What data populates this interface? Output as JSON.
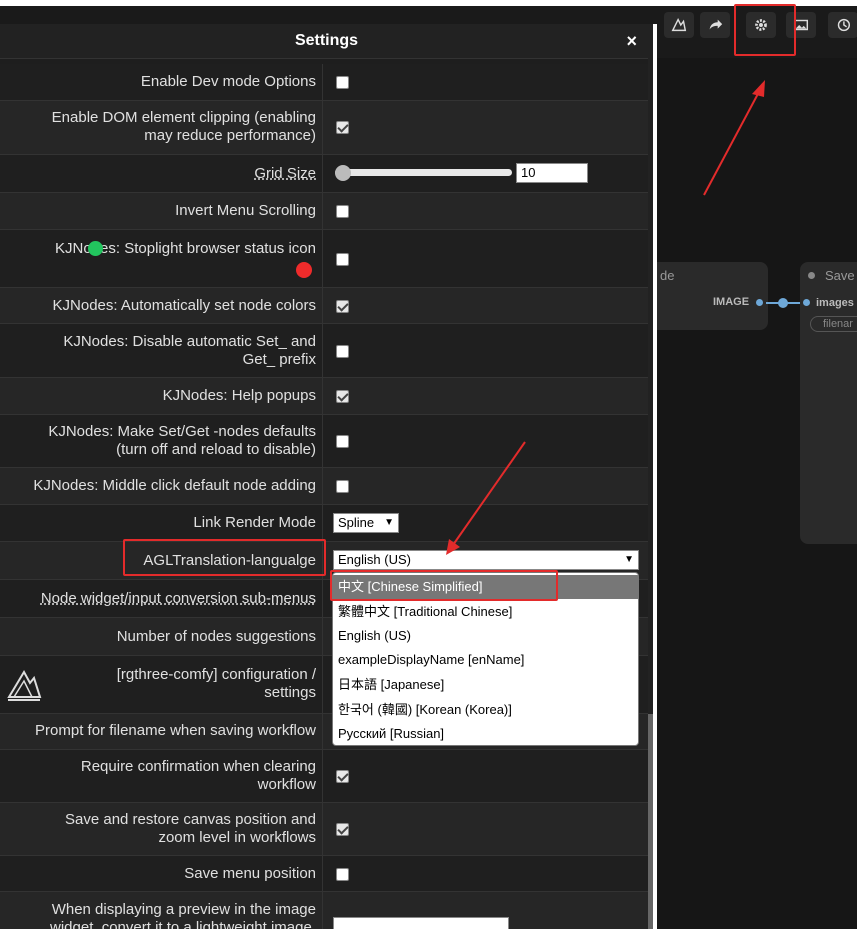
{
  "dialog": {
    "title": "Settings",
    "close_label": "×"
  },
  "settings": {
    "enable_dev_mode": "Enable Dev mode Options",
    "dom_clipping_1": "Enable DOM element clipping (enabling",
    "dom_clipping_2": "may reduce performance)",
    "grid_size": "Grid Size",
    "grid_size_value": "10",
    "invert_menu": "Invert Menu Scrolling",
    "kj_stoplight": "KJNodes:    Stoplight browser status icon",
    "kj_auto_colors": "KJNodes: Automatically set node colors",
    "kj_disable_prefix_1": "KJNodes: Disable automatic Set_ and",
    "kj_disable_prefix_2": "Get_ prefix",
    "kj_help_popups": "KJNodes: Help popups",
    "kj_setget_1": "KJNodes: Make Set/Get -nodes defaults",
    "kj_setget_2": "(turn off and reload to disable)",
    "kj_middle_click": "KJNodes: Middle click default node adding",
    "link_render_mode": "Link Render Mode",
    "link_render_value": "Spline",
    "agl_language": "AGLTranslation-langualge",
    "agl_language_value": "English (US)",
    "node_widget_conv": "Node widget/input conversion sub-menus",
    "num_node_suggestions": "Number of nodes suggestions",
    "rgthree_config_1": "[rgthree-comfy] configuration /",
    "rgthree_config_2": "settings",
    "prompt_filename": "Prompt for filename when saving workflow",
    "require_confirm_1": "Require confirmation when clearing",
    "require_confirm_2": "workflow",
    "save_canvas_pos_1": "Save and restore canvas position and",
    "save_canvas_pos_2": "zoom level in workflows",
    "save_menu_pos": "Save menu position",
    "preview_lightweight_1": "When displaying a preview in the image",
    "preview_lightweight_2": "widget, convert it to a lightweight image,"
  },
  "language_options": [
    "中文 [Chinese Simplified]",
    "繁體中文 [Traditional Chinese]",
    "English (US)",
    "exampleDisplayName [enName]",
    "日本語 [Japanese]",
    "한국어 (韓國) [Korean (Korea)]",
    "Русский [Russian]"
  ],
  "canvas": {
    "node_title_partial": "de",
    "output_label": "IMAGE",
    "save_node_title": "Save",
    "input_label": "images",
    "widget_label": "filenar"
  },
  "colors": {
    "accent_red": "#e32b2b",
    "stoplight_green": "#22c55e",
    "stoplight_red": "#ef2b2b"
  }
}
